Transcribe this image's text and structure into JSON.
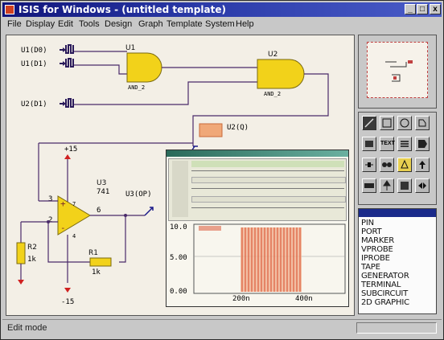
{
  "window": {
    "title": "ISIS for Windows - (untitled template)",
    "min_label": "_",
    "max_label": "□",
    "close_label": "x"
  },
  "menu": [
    "File",
    "Display",
    "Edit",
    "Tools",
    "Design",
    "Graph",
    "Template",
    "System",
    "Help"
  ],
  "schematic": {
    "inputs": [
      "U1(D0)",
      "U1(D1)",
      "U2(D1)"
    ],
    "gates": [
      {
        "ref": "U1",
        "type": "AND_2"
      },
      {
        "ref": "U2",
        "type": "AND_2"
      }
    ],
    "probe_label": "U2(Q)",
    "opamp": {
      "ref": "U3",
      "type": "741",
      "output": "U3(OP)"
    },
    "supply_pos": "+15",
    "supply_neg": "-15",
    "pins": [
      "3",
      "2",
      "6",
      "7",
      "4"
    ],
    "resistors": [
      {
        "ref": "R2",
        "value": "1k"
      },
      {
        "ref": "R1",
        "value": "1k"
      }
    ]
  },
  "graph": {
    "y_ticks": [
      "10.0",
      "5.00",
      "0.00"
    ],
    "x_ticks": [
      "200n",
      "400n"
    ]
  },
  "toolbox": {
    "text_tool_label": "TEXT"
  },
  "object_list": {
    "items": [
      "PIN",
      "PORT",
      "MARKER",
      "VPROBE",
      "IPROBE",
      "TAPE",
      "GENERATOR",
      "TERMINAL",
      "SUBCIRCUIT",
      "2D GRAPHIC"
    ]
  },
  "status": {
    "text": "Edit mode"
  },
  "colors": {
    "titlebar": "#10147a",
    "gate_fill": "#f2d21a",
    "wire": "#4a2a6a",
    "waveform": "#d84a2a",
    "canvas": "#f3efe6"
  }
}
